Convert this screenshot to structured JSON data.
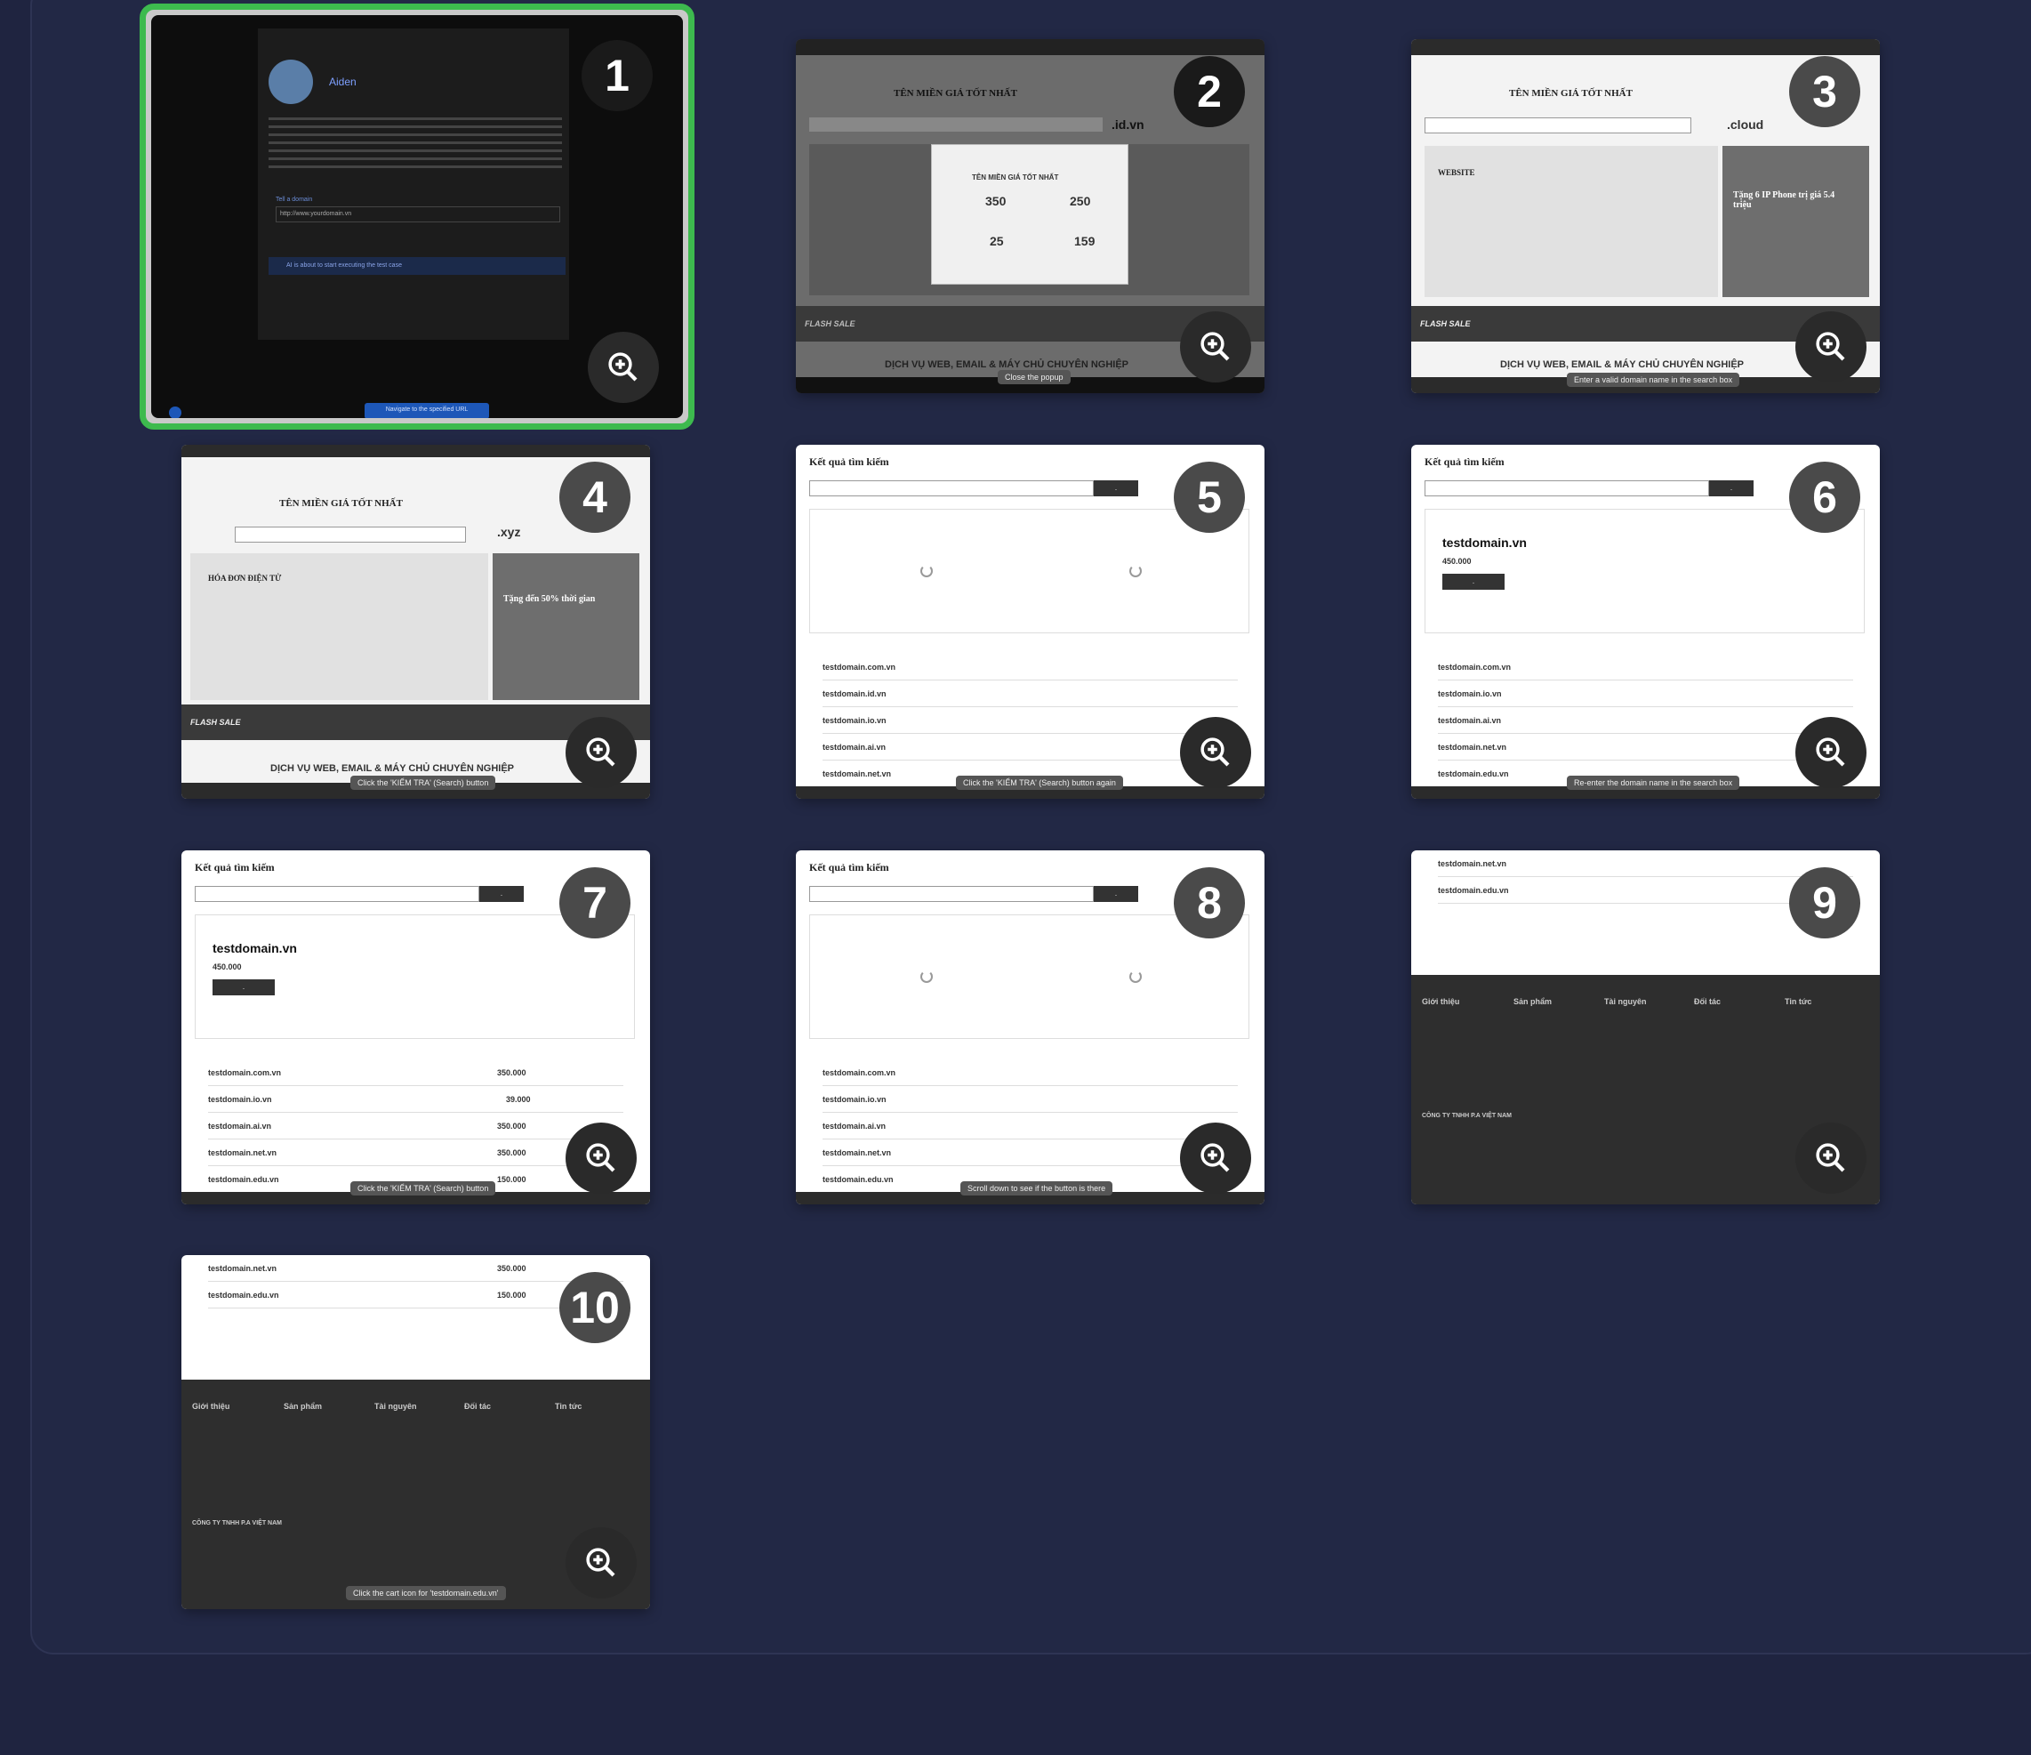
{
  "colors": {
    "background": "#1f2440",
    "selected_border": "#3dba4e",
    "badge": "#1a1a1a"
  },
  "steps": [
    {
      "number": "1",
      "user": "Aiden",
      "input_label": "Tell a domain",
      "input_value": "http://www.yourdomain.vn",
      "status": "AI is about to start executing the test case",
      "action": "Navigate to the specified URL"
    },
    {
      "number": "2",
      "heading": "TÊN MIỀN GIÁ TỐT NHẤT",
      "ext": ".id.vn",
      "modal_title": "TÊN MIỀN GIÁ TỐT NHẤT",
      "p1": "350",
      "p2": "250",
      "p3": "25",
      "p4": "159",
      "banner": "DỊCH VỤ WEB, EMAIL & MÁY CHỦ CHUYÊN NGHIỆP",
      "flash": "FLASH SALE",
      "tip": "Close the popup"
    },
    {
      "number": "3",
      "heading": "TÊN MIỀN GIÁ TỐT NHẤT",
      "ext": ".cloud",
      "promo_title": "WEBSITE",
      "promo_right": "Tặng 6 IP Phone trị giá 5.4 triệu",
      "banner": "DỊCH VỤ WEB, EMAIL & MÁY CHỦ CHUYÊN NGHIỆP",
      "flash": "FLASH SALE",
      "tip": "Enter a valid domain name in the search box"
    },
    {
      "number": "4",
      "heading": "TÊN MIỀN GIÁ TỐT NHẤT",
      "ext": ".xyz",
      "promo_title": "HÓA ĐƠN ĐIỆN TỬ",
      "promo_right": "Tặng đến 50% thời gian",
      "banner": "DỊCH VỤ WEB, EMAIL & MÁY CHỦ CHUYÊN NGHIỆP",
      "flash": "FLASH SALE",
      "tip": "Click the 'KIỂM TRA' (Search) button"
    },
    {
      "number": "5",
      "title": "Kết quả tìm kiếm",
      "rows": [
        "testdomain.com.vn",
        "testdomain.id.vn",
        "testdomain.io.vn",
        "testdomain.ai.vn",
        "testdomain.net.vn"
      ],
      "tip": "Click the 'KIỂM TRA' (Search) button again"
    },
    {
      "number": "6",
      "title": "Kết quả tìm kiếm",
      "domain": "testdomain.vn",
      "price": "450.000",
      "rows": [
        "testdomain.com.vn",
        "testdomain.io.vn",
        "testdomain.ai.vn",
        "testdomain.net.vn",
        "testdomain.edu.vn"
      ],
      "tip": "Re-enter the domain name in the search box"
    },
    {
      "number": "7",
      "title": "Kết quả tìm kiếm",
      "domain": "testdomain.vn",
      "price": "450.000",
      "rows": [
        "testdomain.com.vn",
        "testdomain.io.vn",
        "testdomain.ai.vn",
        "testdomain.net.vn",
        "testdomain.edu.vn"
      ],
      "prices": [
        "350.000",
        "39.000",
        "350.000",
        "350.000",
        "150.000"
      ],
      "tip": "Click the 'KIỂM TRA' (Search) button"
    },
    {
      "number": "8",
      "title": "Kết quả tìm kiếm",
      "rows": [
        "testdomain.com.vn",
        "testdomain.io.vn",
        "testdomain.ai.vn",
        "testdomain.net.vn",
        "testdomain.edu.vn"
      ],
      "tip": "Scroll down to see if the button is there"
    },
    {
      "number": "9",
      "rows": [
        "testdomain.net.vn",
        "testdomain.edu.vn"
      ],
      "cols": [
        "Giới thiệu",
        "Sản phẩm",
        "Tài nguyên",
        "Đối tác",
        "Tin tức"
      ],
      "company": "CÔNG TY TNHH P.A VIỆT NAM"
    },
    {
      "number": "10",
      "rows": [
        "testdomain.net.vn",
        "testdomain.edu.vn"
      ],
      "prices": [
        "350.000",
        "150.000"
      ],
      "cols": [
        "Giới thiệu",
        "Sản phẩm",
        "Tài nguyên",
        "Đối tác",
        "Tin tức"
      ],
      "company": "CÔNG TY TNHH P.A VIỆT NAM",
      "tip": "Click the cart icon for 'testdomain.edu.vn'"
    }
  ]
}
